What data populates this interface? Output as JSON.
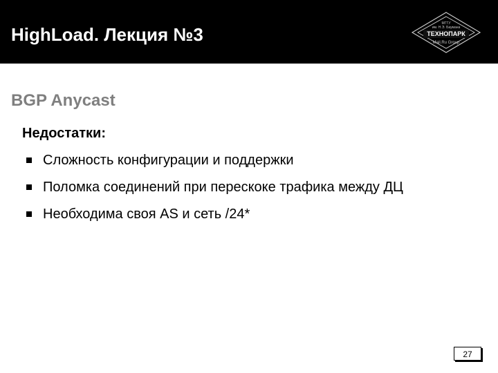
{
  "header": {
    "title": "HighLoad. Лекция №3"
  },
  "logo": {
    "line1": "ТЕХНОПАРК",
    "line2": "Mail.Ru Group"
  },
  "section_title": "BGP Anycast",
  "subhead": "Недостатки:",
  "bullets": [
    "Сложность конфигурации и поддержки",
    "Поломка соединений при перескоке трафика между ДЦ",
    "Необходима своя AS и сеть /24*"
  ],
  "page_number": "27"
}
